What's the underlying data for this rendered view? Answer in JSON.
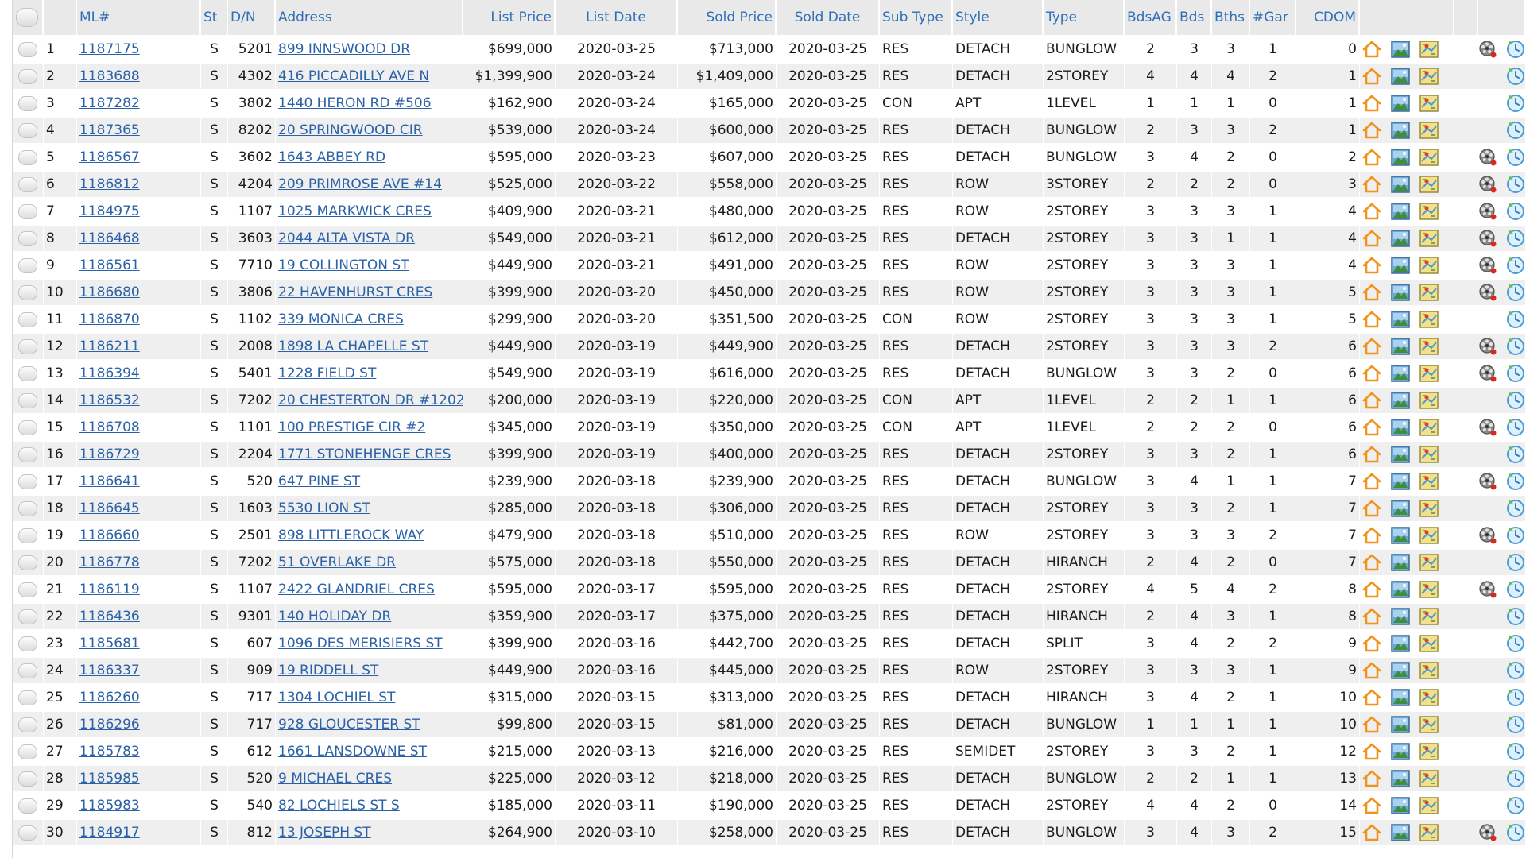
{
  "columns": {
    "select": "",
    "num": "",
    "ml": "ML#",
    "st": "St",
    "dn": "D/N",
    "address": "Address",
    "list_price": "List Price",
    "list_date": "List Date",
    "sold_price": "Sold Price",
    "sold_date": "Sold Date",
    "sub_type": "Sub Type",
    "style": "Style",
    "type": "Type",
    "bdsag": "BdsAG",
    "bds": "Bds",
    "bths": "Bths",
    "gar": "#Gar",
    "cdom": "CDOM"
  },
  "icons": {
    "home": "home-outline-icon",
    "photo": "photo-icon",
    "map": "map-icon",
    "virtual_tour": "film-reel-icon",
    "history": "history-clock-icon"
  },
  "colors": {
    "link": "#2b62a7",
    "header_text": "#2f6fb8",
    "status": "#d22a1f",
    "home_icon": "#f0931c"
  },
  "rows": [
    {
      "n": "1",
      "ml": "1187175",
      "st": "S",
      "dn": "5201",
      "address": "899 INNSWOOD DR",
      "list_price": "$699,000",
      "list_date": "2020-03-25",
      "sold_price": "$713,000",
      "sold_date": "2020-03-25",
      "sub_type": "RES",
      "style": "DETACH",
      "type": "BUNGLOW",
      "bdsag": "2",
      "bds": "3",
      "bths": "3",
      "gar": "1",
      "cdom": "0",
      "tour": true
    },
    {
      "n": "2",
      "ml": "1183688",
      "st": "S",
      "dn": "4302",
      "address": "416 PICCADILLY AVE N",
      "list_price": "$1,399,900",
      "list_date": "2020-03-24",
      "sold_price": "$1,409,000",
      "sold_date": "2020-03-25",
      "sub_type": "RES",
      "style": "DETACH",
      "type": "2STOREY",
      "bdsag": "4",
      "bds": "4",
      "bths": "4",
      "gar": "2",
      "cdom": "1",
      "tour": false
    },
    {
      "n": "3",
      "ml": "1187282",
      "st": "S",
      "dn": "3802",
      "address": "1440 HERON RD #506",
      "list_price": "$162,900",
      "list_date": "2020-03-24",
      "sold_price": "$165,000",
      "sold_date": "2020-03-25",
      "sub_type": "CON",
      "style": "APT",
      "type": "1LEVEL",
      "bdsag": "1",
      "bds": "1",
      "bths": "1",
      "gar": "0",
      "cdom": "1",
      "tour": false
    },
    {
      "n": "4",
      "ml": "1187365",
      "st": "S",
      "dn": "8202",
      "address": "20 SPRINGWOOD CIR",
      "list_price": "$539,000",
      "list_date": "2020-03-24",
      "sold_price": "$600,000",
      "sold_date": "2020-03-25",
      "sub_type": "RES",
      "style": "DETACH",
      "type": "BUNGLOW",
      "bdsag": "2",
      "bds": "3",
      "bths": "3",
      "gar": "2",
      "cdom": "1",
      "tour": false
    },
    {
      "n": "5",
      "ml": "1186567",
      "st": "S",
      "dn": "3602",
      "address": "1643 ABBEY RD",
      "list_price": "$595,000",
      "list_date": "2020-03-23",
      "sold_price": "$607,000",
      "sold_date": "2020-03-25",
      "sub_type": "RES",
      "style": "DETACH",
      "type": "BUNGLOW",
      "bdsag": "3",
      "bds": "4",
      "bths": "2",
      "gar": "0",
      "cdom": "2",
      "tour": true
    },
    {
      "n": "6",
      "ml": "1186812",
      "st": "S",
      "dn": "4204",
      "address": "209 PRIMROSE AVE #14",
      "list_price": "$525,000",
      "list_date": "2020-03-22",
      "sold_price": "$558,000",
      "sold_date": "2020-03-25",
      "sub_type": "RES",
      "style": "ROW",
      "type": "3STOREY",
      "bdsag": "2",
      "bds": "2",
      "bths": "2",
      "gar": "0",
      "cdom": "3",
      "tour": true
    },
    {
      "n": "7",
      "ml": "1184975",
      "st": "S",
      "dn": "1107",
      "address": "1025 MARKWICK CRES",
      "list_price": "$409,900",
      "list_date": "2020-03-21",
      "sold_price": "$480,000",
      "sold_date": "2020-03-25",
      "sub_type": "RES",
      "style": "ROW",
      "type": "2STOREY",
      "bdsag": "3",
      "bds": "3",
      "bths": "3",
      "gar": "1",
      "cdom": "4",
      "tour": true
    },
    {
      "n": "8",
      "ml": "1186468",
      "st": "S",
      "dn": "3603",
      "address": "2044 ALTA VISTA DR",
      "list_price": "$549,000",
      "list_date": "2020-03-21",
      "sold_price": "$612,000",
      "sold_date": "2020-03-25",
      "sub_type": "RES",
      "style": "DETACH",
      "type": "2STOREY",
      "bdsag": "3",
      "bds": "3",
      "bths": "1",
      "gar": "1",
      "cdom": "4",
      "tour": true
    },
    {
      "n": "9",
      "ml": "1186561",
      "st": "S",
      "dn": "7710",
      "address": "19 COLLINGTON ST",
      "list_price": "$449,900",
      "list_date": "2020-03-21",
      "sold_price": "$491,000",
      "sold_date": "2020-03-25",
      "sub_type": "RES",
      "style": "ROW",
      "type": "2STOREY",
      "bdsag": "3",
      "bds": "3",
      "bths": "3",
      "gar": "1",
      "cdom": "4",
      "tour": true
    },
    {
      "n": "10",
      "ml": "1186680",
      "st": "S",
      "dn": "3806",
      "address": "22 HAVENHURST CRES",
      "list_price": "$399,900",
      "list_date": "2020-03-20",
      "sold_price": "$450,000",
      "sold_date": "2020-03-25",
      "sub_type": "RES",
      "style": "ROW",
      "type": "2STOREY",
      "bdsag": "3",
      "bds": "3",
      "bths": "3",
      "gar": "1",
      "cdom": "5",
      "tour": true
    },
    {
      "n": "11",
      "ml": "1186870",
      "st": "S",
      "dn": "1102",
      "address": "339 MONICA CRES",
      "list_price": "$299,900",
      "list_date": "2020-03-20",
      "sold_price": "$351,500",
      "sold_date": "2020-03-25",
      "sub_type": "CON",
      "style": "ROW",
      "type": "2STOREY",
      "bdsag": "3",
      "bds": "3",
      "bths": "3",
      "gar": "1",
      "cdom": "5",
      "tour": false
    },
    {
      "n": "12",
      "ml": "1186211",
      "st": "S",
      "dn": "2008",
      "address": "1898 LA CHAPELLE ST",
      "list_price": "$449,900",
      "list_date": "2020-03-19",
      "sold_price": "$449,900",
      "sold_date": "2020-03-25",
      "sub_type": "RES",
      "style": "DETACH",
      "type": "2STOREY",
      "bdsag": "3",
      "bds": "3",
      "bths": "3",
      "gar": "2",
      "cdom": "6",
      "tour": true
    },
    {
      "n": "13",
      "ml": "1186394",
      "st": "S",
      "dn": "5401",
      "address": "1228 FIELD ST",
      "list_price": "$549,900",
      "list_date": "2020-03-19",
      "sold_price": "$616,000",
      "sold_date": "2020-03-25",
      "sub_type": "RES",
      "style": "DETACH",
      "type": "BUNGLOW",
      "bdsag": "3",
      "bds": "3",
      "bths": "2",
      "gar": "0",
      "cdom": "6",
      "tour": true
    },
    {
      "n": "14",
      "ml": "1186532",
      "st": "S",
      "dn": "7202",
      "address": "20 CHESTERTON DR #1202",
      "list_price": "$200,000",
      "list_date": "2020-03-19",
      "sold_price": "$220,000",
      "sold_date": "2020-03-25",
      "sub_type": "CON",
      "style": "APT",
      "type": "1LEVEL",
      "bdsag": "2",
      "bds": "2",
      "bths": "1",
      "gar": "1",
      "cdom": "6",
      "tour": false
    },
    {
      "n": "15",
      "ml": "1186708",
      "st": "S",
      "dn": "1101",
      "address": "100 PRESTIGE CIR #2",
      "list_price": "$345,000",
      "list_date": "2020-03-19",
      "sold_price": "$350,000",
      "sold_date": "2020-03-25",
      "sub_type": "CON",
      "style": "APT",
      "type": "1LEVEL",
      "bdsag": "2",
      "bds": "2",
      "bths": "2",
      "gar": "0",
      "cdom": "6",
      "tour": true
    },
    {
      "n": "16",
      "ml": "1186729",
      "st": "S",
      "dn": "2204",
      "address": "1771 STONEHENGE CRES",
      "list_price": "$399,900",
      "list_date": "2020-03-19",
      "sold_price": "$400,000",
      "sold_date": "2020-03-25",
      "sub_type": "RES",
      "style": "DETACH",
      "type": "2STOREY",
      "bdsag": "3",
      "bds": "3",
      "bths": "2",
      "gar": "1",
      "cdom": "6",
      "tour": false
    },
    {
      "n": "17",
      "ml": "1186641",
      "st": "S",
      "dn": "520",
      "address": "647 PINE ST",
      "list_price": "$239,900",
      "list_date": "2020-03-18",
      "sold_price": "$239,900",
      "sold_date": "2020-03-25",
      "sub_type": "RES",
      "style": "DETACH",
      "type": "BUNGLOW",
      "bdsag": "3",
      "bds": "4",
      "bths": "1",
      "gar": "1",
      "cdom": "7",
      "tour": true
    },
    {
      "n": "18",
      "ml": "1186645",
      "st": "S",
      "dn": "1603",
      "address": "5530 LION ST",
      "list_price": "$285,000",
      "list_date": "2020-03-18",
      "sold_price": "$306,000",
      "sold_date": "2020-03-25",
      "sub_type": "RES",
      "style": "DETACH",
      "type": "2STOREY",
      "bdsag": "3",
      "bds": "3",
      "bths": "2",
      "gar": "1",
      "cdom": "7",
      "tour": false
    },
    {
      "n": "19",
      "ml": "1186660",
      "st": "S",
      "dn": "2501",
      "address": "898 LITTLEROCK WAY",
      "list_price": "$479,900",
      "list_date": "2020-03-18",
      "sold_price": "$510,000",
      "sold_date": "2020-03-25",
      "sub_type": "RES",
      "style": "ROW",
      "type": "2STOREY",
      "bdsag": "3",
      "bds": "3",
      "bths": "3",
      "gar": "2",
      "cdom": "7",
      "tour": true
    },
    {
      "n": "20",
      "ml": "1186778",
      "st": "S",
      "dn": "7202",
      "address": "51 OVERLAKE DR",
      "list_price": "$575,000",
      "list_date": "2020-03-18",
      "sold_price": "$550,000",
      "sold_date": "2020-03-25",
      "sub_type": "RES",
      "style": "DETACH",
      "type": "HIRANCH",
      "bdsag": "2",
      "bds": "4",
      "bths": "2",
      "gar": "0",
      "cdom": "7",
      "tour": false
    },
    {
      "n": "21",
      "ml": "1186119",
      "st": "S",
      "dn": "1107",
      "address": "2422 GLANDRIEL CRES",
      "list_price": "$595,000",
      "list_date": "2020-03-17",
      "sold_price": "$595,000",
      "sold_date": "2020-03-25",
      "sub_type": "RES",
      "style": "DETACH",
      "type": "2STOREY",
      "bdsag": "4",
      "bds": "5",
      "bths": "4",
      "gar": "2",
      "cdom": "8",
      "tour": true
    },
    {
      "n": "22",
      "ml": "1186436",
      "st": "S",
      "dn": "9301",
      "address": "140 HOLIDAY DR",
      "list_price": "$359,900",
      "list_date": "2020-03-17",
      "sold_price": "$375,000",
      "sold_date": "2020-03-25",
      "sub_type": "RES",
      "style": "DETACH",
      "type": "HIRANCH",
      "bdsag": "2",
      "bds": "4",
      "bths": "3",
      "gar": "1",
      "cdom": "8",
      "tour": false
    },
    {
      "n": "23",
      "ml": "1185681",
      "st": "S",
      "dn": "607",
      "address": "1096 DES MERISIERS ST",
      "list_price": "$399,900",
      "list_date": "2020-03-16",
      "sold_price": "$442,700",
      "sold_date": "2020-03-25",
      "sub_type": "RES",
      "style": "DETACH",
      "type": "SPLIT",
      "bdsag": "3",
      "bds": "4",
      "bths": "2",
      "gar": "2",
      "cdom": "9",
      "tour": false
    },
    {
      "n": "24",
      "ml": "1186337",
      "st": "S",
      "dn": "909",
      "address": "19 RIDDELL ST",
      "list_price": "$449,900",
      "list_date": "2020-03-16",
      "sold_price": "$445,000",
      "sold_date": "2020-03-25",
      "sub_type": "RES",
      "style": "ROW",
      "type": "2STOREY",
      "bdsag": "3",
      "bds": "3",
      "bths": "3",
      "gar": "1",
      "cdom": "9",
      "tour": false
    },
    {
      "n": "25",
      "ml": "1186260",
      "st": "S",
      "dn": "717",
      "address": "1304 LOCHIEL ST",
      "list_price": "$315,000",
      "list_date": "2020-03-15",
      "sold_price": "$313,000",
      "sold_date": "2020-03-25",
      "sub_type": "RES",
      "style": "DETACH",
      "type": "HIRANCH",
      "bdsag": "3",
      "bds": "4",
      "bths": "2",
      "gar": "1",
      "cdom": "10",
      "tour": false
    },
    {
      "n": "26",
      "ml": "1186296",
      "st": "S",
      "dn": "717",
      "address": "928 GLOUCESTER ST",
      "list_price": "$99,800",
      "list_date": "2020-03-15",
      "sold_price": "$81,000",
      "sold_date": "2020-03-25",
      "sub_type": "RES",
      "style": "DETACH",
      "type": "BUNGLOW",
      "bdsag": "1",
      "bds": "1",
      "bths": "1",
      "gar": "1",
      "cdom": "10",
      "tour": false
    },
    {
      "n": "27",
      "ml": "1185783",
      "st": "S",
      "dn": "612",
      "address": "1661 LANSDOWNE ST",
      "list_price": "$215,000",
      "list_date": "2020-03-13",
      "sold_price": "$216,000",
      "sold_date": "2020-03-25",
      "sub_type": "RES",
      "style": "SEMIDET",
      "type": "2STOREY",
      "bdsag": "3",
      "bds": "3",
      "bths": "2",
      "gar": "1",
      "cdom": "12",
      "tour": false
    },
    {
      "n": "28",
      "ml": "1185985",
      "st": "S",
      "dn": "520",
      "address": "9 MICHAEL CRES",
      "list_price": "$225,000",
      "list_date": "2020-03-12",
      "sold_price": "$218,000",
      "sold_date": "2020-03-25",
      "sub_type": "RES",
      "style": "DETACH",
      "type": "BUNGLOW",
      "bdsag": "2",
      "bds": "2",
      "bths": "1",
      "gar": "1",
      "cdom": "13",
      "tour": false
    },
    {
      "n": "29",
      "ml": "1185983",
      "st": "S",
      "dn": "540",
      "address": "82 LOCHIELS ST S",
      "list_price": "$185,000",
      "list_date": "2020-03-11",
      "sold_price": "$190,000",
      "sold_date": "2020-03-25",
      "sub_type": "RES",
      "style": "DETACH",
      "type": "2STOREY",
      "bdsag": "4",
      "bds": "4",
      "bths": "2",
      "gar": "0",
      "cdom": "14",
      "tour": false
    },
    {
      "n": "30",
      "ml": "1184917",
      "st": "S",
      "dn": "812",
      "address": "13 JOSEPH ST",
      "list_price": "$264,900",
      "list_date": "2020-03-10",
      "sold_price": "$258,000",
      "sold_date": "2020-03-25",
      "sub_type": "RES",
      "style": "DETACH",
      "type": "BUNGLOW",
      "bdsag": "3",
      "bds": "4",
      "bths": "3",
      "gar": "2",
      "cdom": "15",
      "tour": true
    }
  ]
}
